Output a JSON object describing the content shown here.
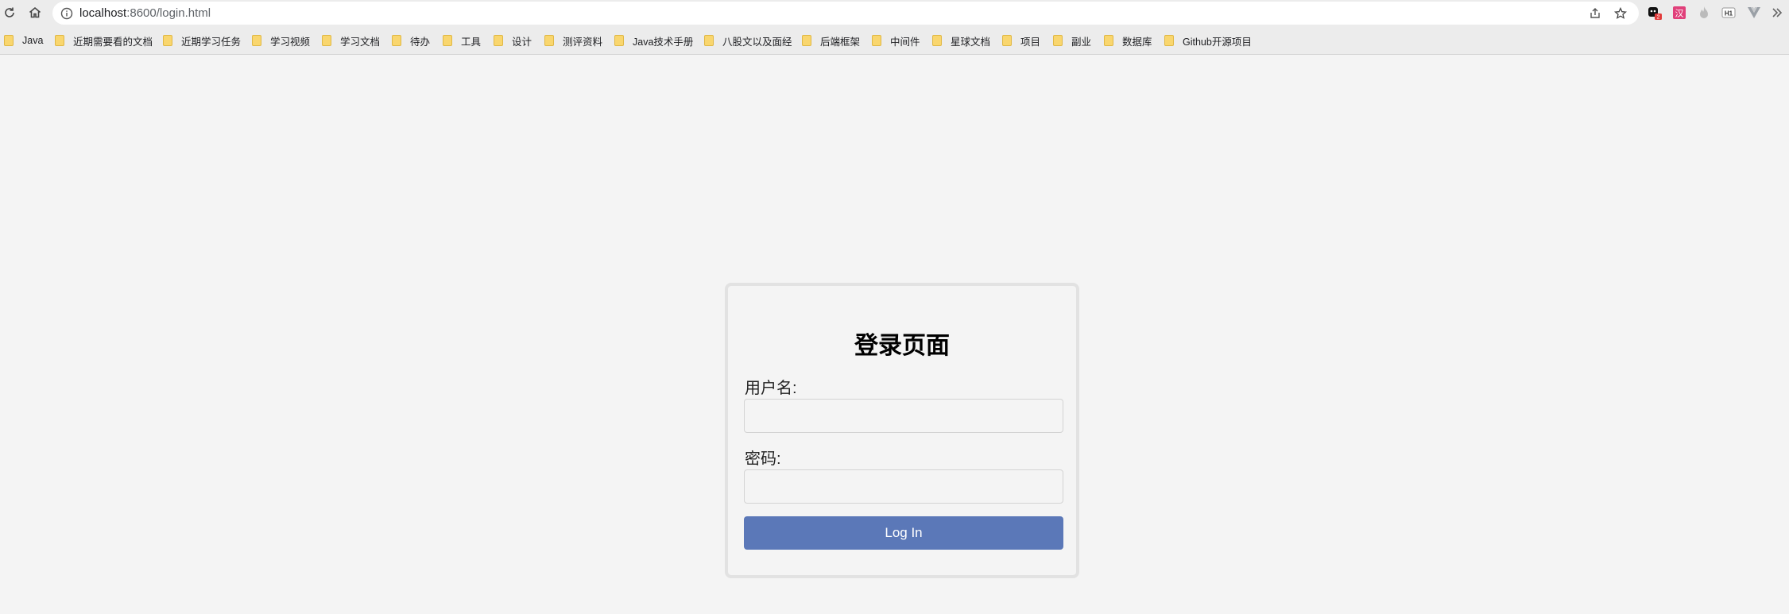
{
  "browser": {
    "address": {
      "host": "localhost",
      "path": ":8600/login.html"
    },
    "extensions": [
      {
        "name": "ext-ai-icon",
        "badge": "2"
      },
      {
        "name": "ext-translate-icon",
        "text": "汉"
      },
      {
        "name": "ext-flame-icon"
      },
      {
        "name": "ext-h1-icon",
        "text": "H1"
      },
      {
        "name": "ext-vue-icon"
      }
    ],
    "accent_color": "#5b78b8"
  },
  "bookmarks": [
    {
      "label": "Java"
    },
    {
      "label": "近期需要看的文档"
    },
    {
      "label": "近期学习任务"
    },
    {
      "label": "学习视频"
    },
    {
      "label": "学习文档"
    },
    {
      "label": "待办"
    },
    {
      "label": "工具"
    },
    {
      "label": "设计"
    },
    {
      "label": "测评资料"
    },
    {
      "label": "Java技术手册"
    },
    {
      "label": "八股文以及面经"
    },
    {
      "label": "后端框架"
    },
    {
      "label": "中间件"
    },
    {
      "label": "星球文档"
    },
    {
      "label": "项目"
    },
    {
      "label": "副业"
    },
    {
      "label": "数据库"
    },
    {
      "label": "Github开源项目"
    }
  ],
  "login": {
    "title": "登录页面",
    "username_label": "用户名:",
    "username_value": "",
    "password_label": "密码:",
    "password_value": "",
    "submit_label": "Log In"
  }
}
